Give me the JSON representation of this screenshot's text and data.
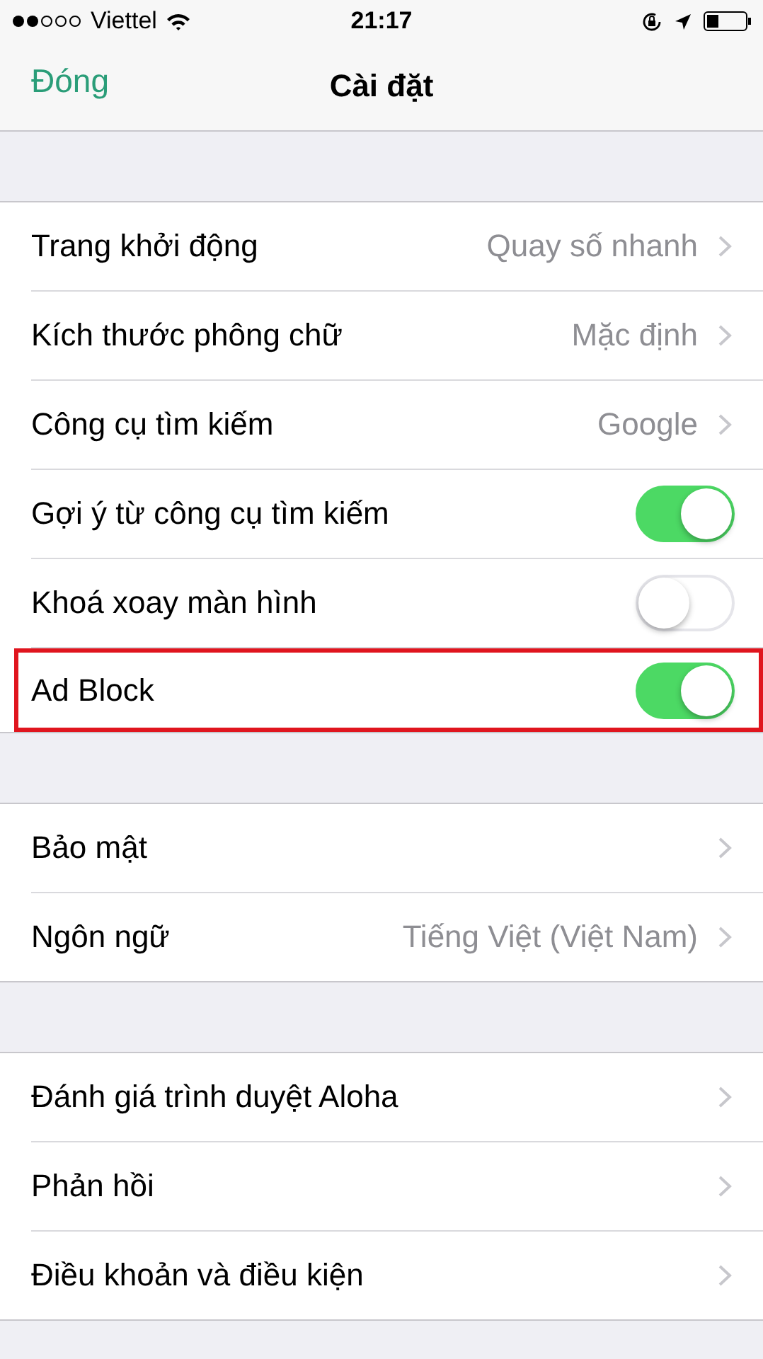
{
  "status_bar": {
    "carrier": "Viettel",
    "time": "21:17"
  },
  "nav": {
    "back": "Đóng",
    "title": "Cài đặt"
  },
  "sections": [
    {
      "rows": [
        {
          "kind": "value",
          "label": "Trang khởi động",
          "value": "Quay số nhanh"
        },
        {
          "kind": "value",
          "label": "Kích thước phông chữ",
          "value": "Mặc định"
        },
        {
          "kind": "value",
          "label": "Công cụ tìm kiếm",
          "value": "Google"
        },
        {
          "kind": "toggle",
          "label": "Gợi ý từ công cụ tìm kiếm",
          "on": true,
          "highlighted": false
        },
        {
          "kind": "toggle",
          "label": "Khoá xoay màn hình",
          "on": false,
          "highlighted": false
        },
        {
          "kind": "toggle",
          "label": "Ad Block",
          "on": true,
          "highlighted": true
        }
      ]
    },
    {
      "rows": [
        {
          "kind": "link",
          "label": "Bảo mật"
        },
        {
          "kind": "value",
          "label": "Ngôn ngữ",
          "value": "Tiếng Việt (Việt Nam)"
        }
      ]
    },
    {
      "rows": [
        {
          "kind": "link",
          "label": "Đánh giá trình duyệt Aloha"
        },
        {
          "kind": "link",
          "label": "Phản hồi"
        },
        {
          "kind": "link",
          "label": "Điều khoản và điều kiện"
        }
      ]
    }
  ]
}
